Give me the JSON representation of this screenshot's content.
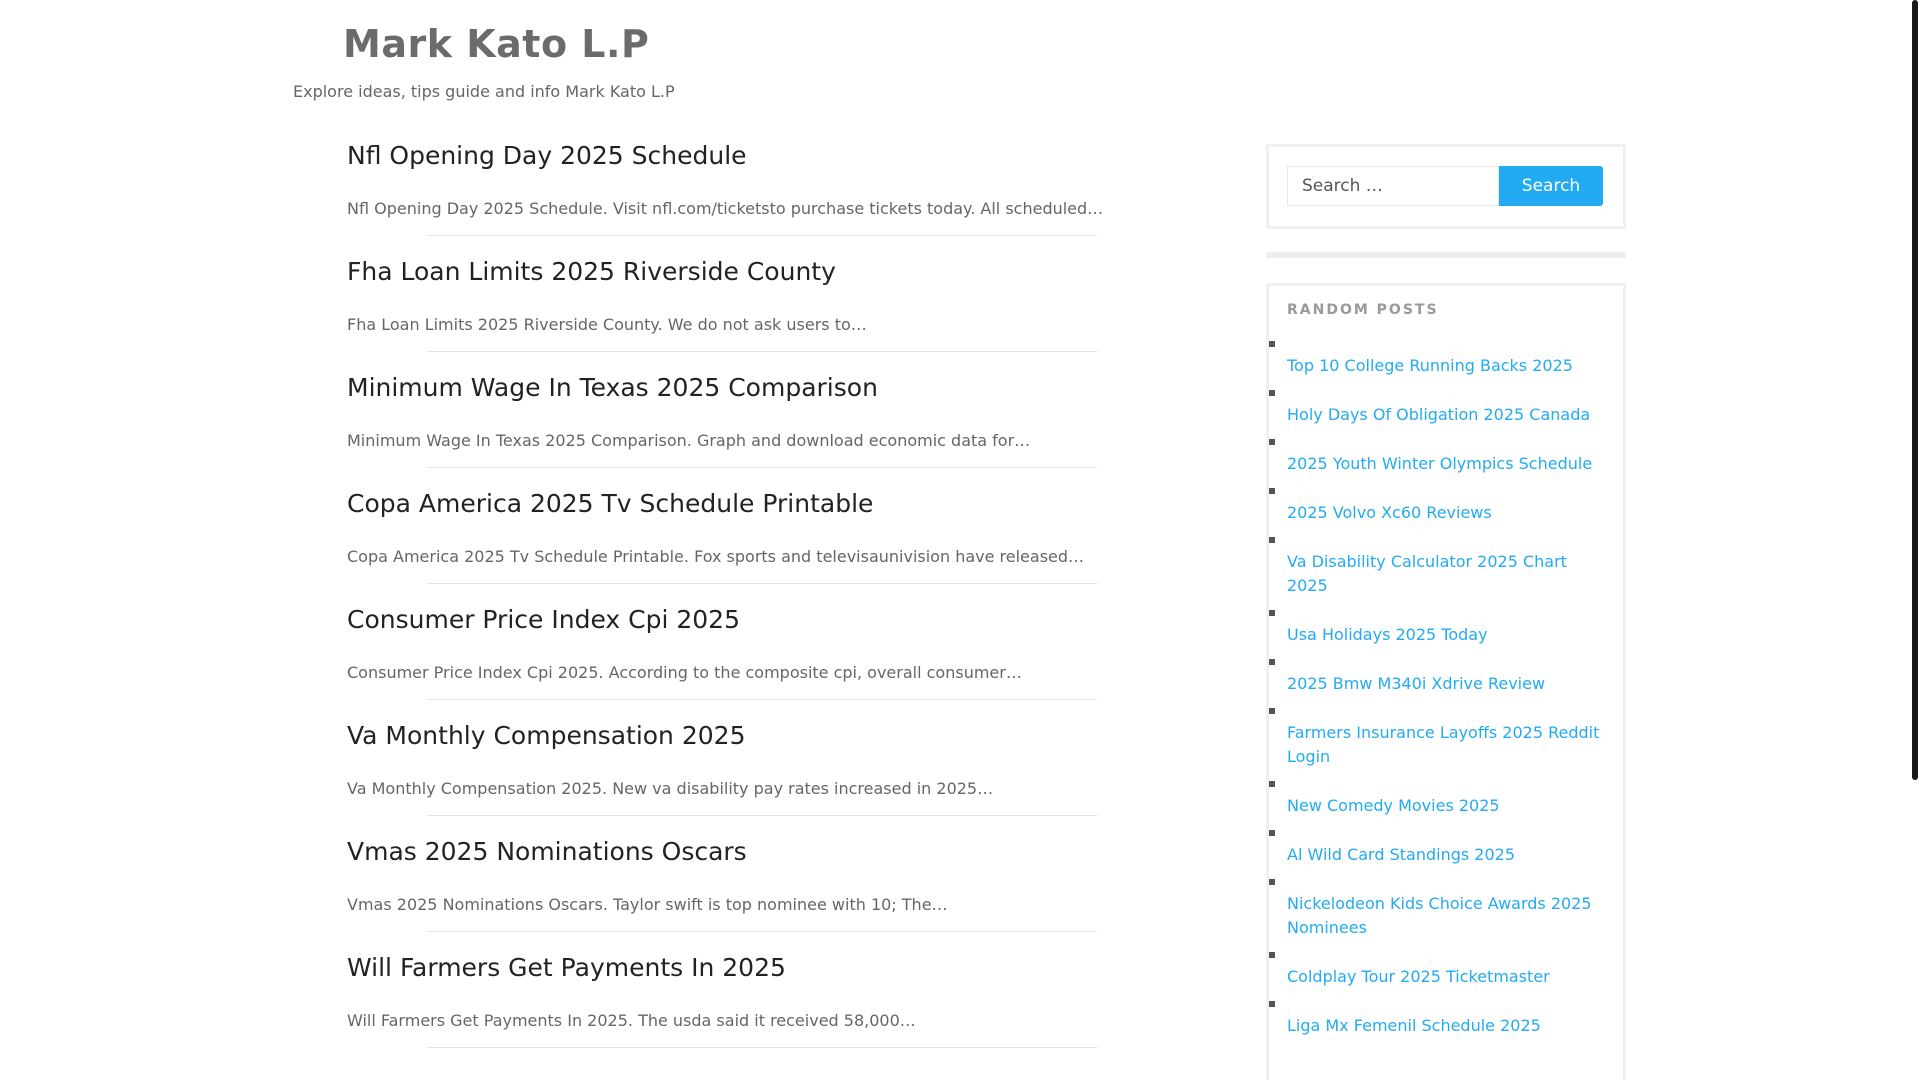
{
  "site": {
    "title": "Mark Kato L.P",
    "description": "Explore ideas, tips guide and info Mark Kato L.P"
  },
  "posts": [
    {
      "title": "Nfl Opening Day 2025 Schedule",
      "excerpt": "Nfl Opening Day 2025 Schedule. Visit nfl.com/ticketsto purchase tickets today. All scheduled…"
    },
    {
      "title": "Fha Loan Limits 2025 Riverside County",
      "excerpt": "Fha Loan Limits 2025 Riverside County. We do not ask users to…"
    },
    {
      "title": "Minimum Wage In Texas 2025 Comparison",
      "excerpt": "Minimum Wage In Texas 2025 Comparison. Graph and download economic data for…"
    },
    {
      "title": "Copa America 2025 Tv Schedule Printable",
      "excerpt": "Copa America 2025 Tv Schedule Printable. Fox sports and televisaunivision have released…"
    },
    {
      "title": "Consumer Price Index Cpi 2025",
      "excerpt": "Consumer Price Index Cpi 2025. According to the composite cpi, overall consumer…"
    },
    {
      "title": "Va Monthly Compensation 2025",
      "excerpt": "Va Monthly Compensation 2025. New va disability pay rates increased in 2025…"
    },
    {
      "title": "Vmas 2025 Nominations Oscars",
      "excerpt": "Vmas 2025 Nominations Oscars. Taylor swift is top nominee with 10; The…"
    },
    {
      "title": "Will Farmers Get Payments In 2025",
      "excerpt": "Will Farmers Get Payments In 2025. The usda said it received 58,000…"
    }
  ],
  "search": {
    "placeholder": "Search …",
    "button_label": "Search"
  },
  "random_posts": {
    "title": "RANDOM POSTS",
    "items": [
      "Top 10 College Running Backs 2025",
      "Holy Days Of Obligation 2025 Canada",
      "2025 Youth Winter Olympics Schedule",
      "2025 Volvo Xc60 Reviews",
      "Va Disability Calculator 2025 Chart 2025",
      "Usa Holidays 2025 Today",
      "2025 Bmw M340i Xdrive Review",
      "Farmers Insurance Layoffs 2025 Reddit Login",
      "New Comedy Movies 2025",
      "Al Wild Card Standings 2025",
      "Nickelodeon Kids Choice Awards 2025 Nominees",
      "Coldplay Tour 2025 Ticketmaster",
      "Liga Mx Femenil Schedule 2025"
    ]
  },
  "colors": {
    "link": "#22abf3",
    "button": "#22abf3"
  }
}
